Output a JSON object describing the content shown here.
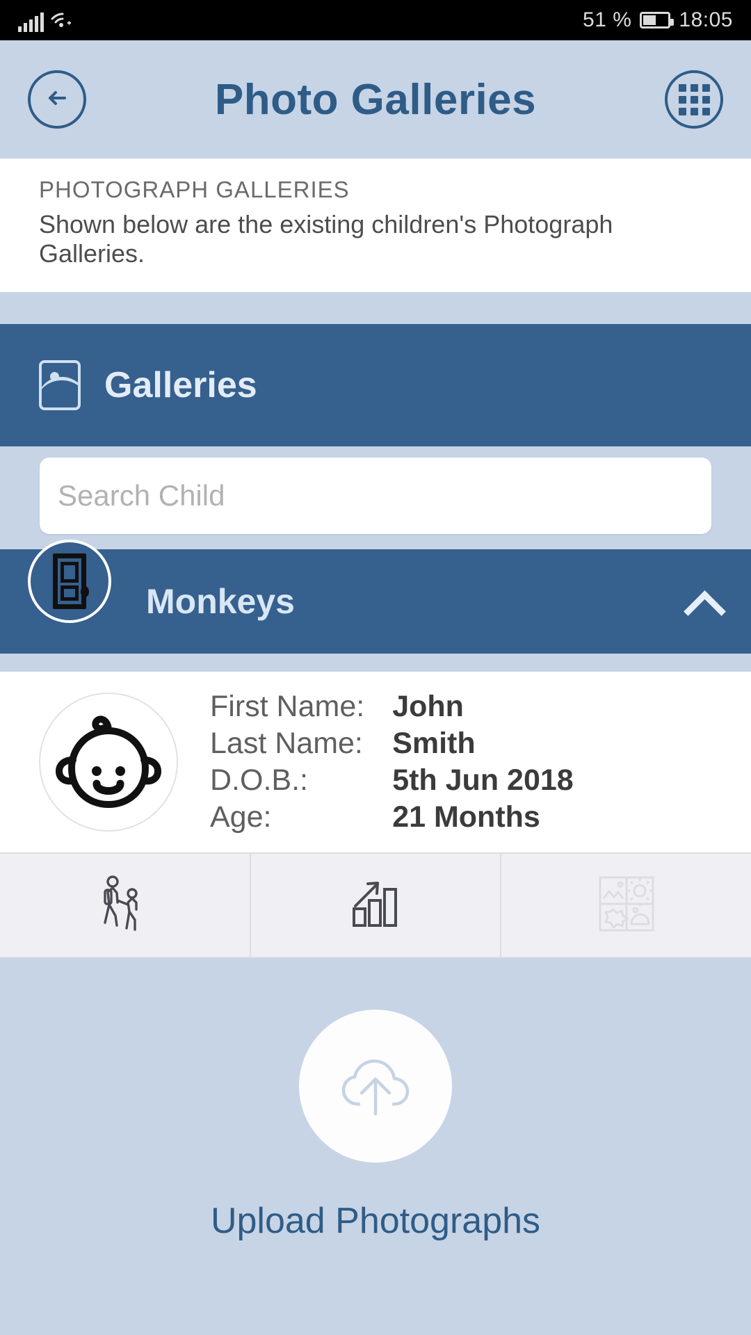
{
  "status_bar": {
    "battery_percent": "51 %",
    "time": "18:05",
    "signal_icon": "signal-bars-icon",
    "wifi_icon": "wifi-icon",
    "battery_icon": "battery-icon"
  },
  "header": {
    "title": "Photo Galleries",
    "back_icon": "back-arrow-icon",
    "menu_icon": "grid-menu-icon"
  },
  "intro": {
    "title": "PHOTOGRAPH GALLERIES",
    "description": "Shown below are the existing children's Photograph Galleries."
  },
  "galleries_section": {
    "label": "Galleries",
    "icon": "photo-image-icon"
  },
  "search": {
    "placeholder": "Search Child",
    "value": ""
  },
  "group": {
    "name": "Monkeys",
    "avatar_icon": "door-icon",
    "expand_icon": "chevron-up-icon",
    "expanded": true
  },
  "child": {
    "avatar_icon": "baby-face-icon",
    "fields": [
      {
        "label": "First Name:",
        "value": "John"
      },
      {
        "label": "Last Name:",
        "value": "Smith"
      },
      {
        "label": "D.O.B.:",
        "value": "5th Jun 2018"
      },
      {
        "label": "Age:",
        "value": "21 Months"
      }
    ]
  },
  "actions": [
    {
      "name": "child-walking-action",
      "icon": "parent-child-walking-icon"
    },
    {
      "name": "progress-chart-action",
      "icon": "bar-chart-arrow-icon"
    },
    {
      "name": "photo-gallery-action",
      "icon": "photo-grid-icon"
    }
  ],
  "upload": {
    "label": "Upload Photographs",
    "icon": "cloud-upload-icon"
  },
  "colors": {
    "primary_blue": "#36608d",
    "light_blue": "#c6d4e6",
    "title_blue": "#2f5c87",
    "panel_white": "#ffffff",
    "action_strip": "#f0f0f4"
  }
}
